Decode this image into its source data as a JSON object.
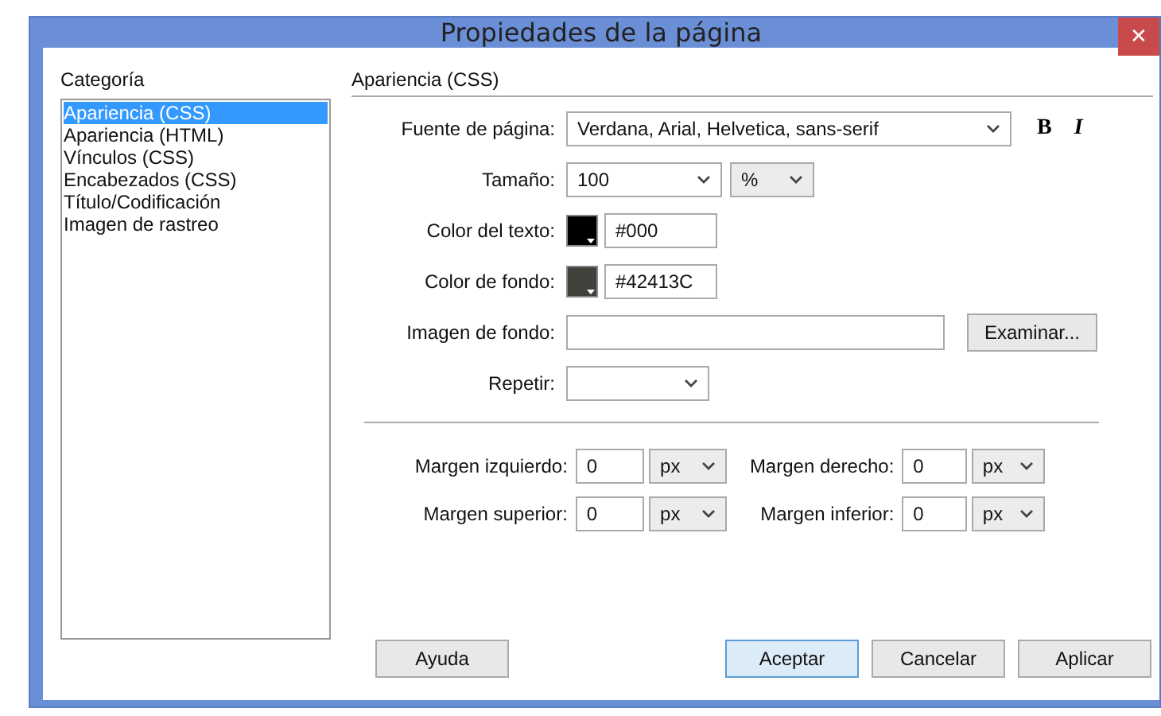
{
  "window": {
    "title": "Propiedades de la página",
    "close": "✕"
  },
  "sidebar": {
    "heading": "Categoría",
    "items": [
      {
        "label": "Apariencia (CSS)",
        "selected": true
      },
      {
        "label": "Apariencia (HTML)",
        "selected": false
      },
      {
        "label": "Vínculos (CSS)",
        "selected": false
      },
      {
        "label": "Encabezados (CSS)",
        "selected": false
      },
      {
        "label": "Título/Codificación",
        "selected": false
      },
      {
        "label": "Imagen de rastreo",
        "selected": false
      }
    ]
  },
  "panel": {
    "heading": "Apariencia (CSS)",
    "fields": [
      {
        "kind": "font",
        "label": "Fuente de página:",
        "value": "Verdana, Arial, Helvetica, sans-serif",
        "bold": "B",
        "italic": "I"
      },
      {
        "kind": "size",
        "label": "Tamaño:",
        "value": "100",
        "unit": "%"
      },
      {
        "kind": "color",
        "label": "Color del texto:",
        "value": "#000"
      },
      {
        "kind": "color",
        "label": "Color de fondo:",
        "value": "#42413C"
      },
      {
        "kind": "file",
        "label": "Imagen de fondo:",
        "button": "Examinar..."
      },
      {
        "kind": "repeat",
        "label": "Repetir:"
      }
    ],
    "margins": [
      {
        "label": "Margen izquierdo:",
        "value": "0",
        "unit": "px"
      },
      {
        "label": "Margen derecho:",
        "value": "0",
        "unit": "px"
      },
      {
        "label": "Margen superior:",
        "value": "0",
        "unit": "px"
      },
      {
        "label": "Margen inferior:",
        "value": "0",
        "unit": "px"
      }
    ]
  },
  "buttons": [
    {
      "label": "Ayuda",
      "default": false
    },
    {
      "label": "Aceptar",
      "default": true
    },
    {
      "label": "Cancelar",
      "default": false
    },
    {
      "label": "Aplicar",
      "default": false
    }
  ]
}
